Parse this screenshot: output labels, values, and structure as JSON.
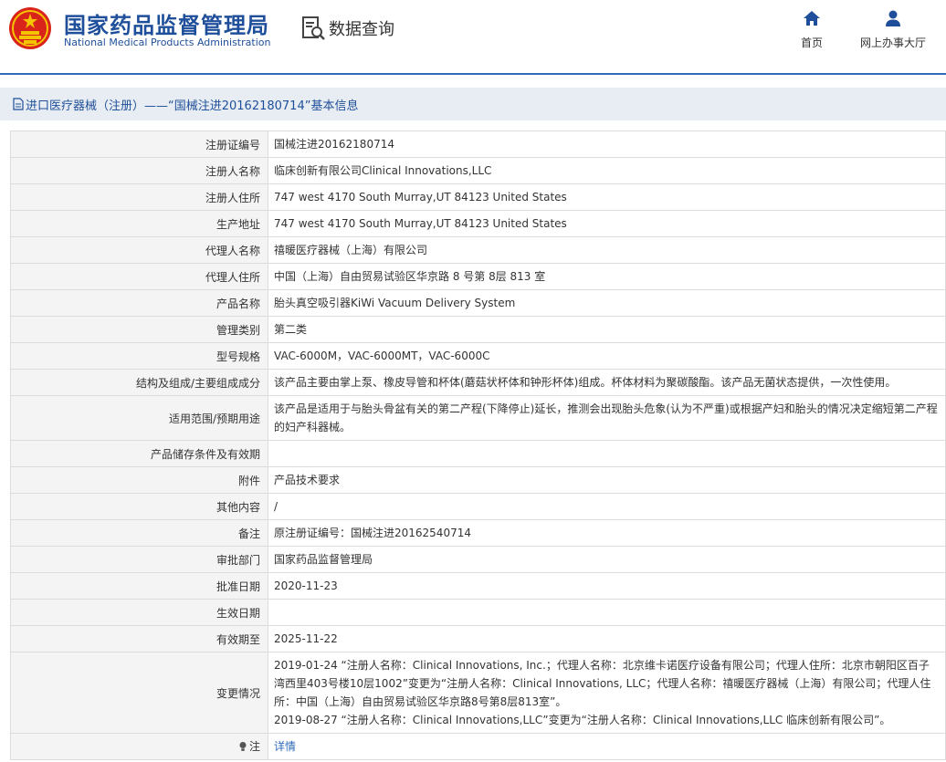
{
  "header": {
    "brand_cn": "国家药品监督管理局",
    "brand_en": "National Medical Products Administration",
    "query_label": "数据查询",
    "nav_home": "首页",
    "nav_hall": "网上办事大厅",
    "brand_color": "#1f4f9a",
    "emblem_color": "#d9241c"
  },
  "breadcrumb": "进口医疗器械（注册）——“国械注进20162180714”基本信息",
  "rows": [
    {
      "label": "注册证编号",
      "value": "国械注进20162180714"
    },
    {
      "label": "注册人名称",
      "value": "临床创新有限公司Clinical Innovations,LLC"
    },
    {
      "label": "注册人住所",
      "value": "747 west 4170 South Murray,UT 84123 United States"
    },
    {
      "label": "生产地址",
      "value": "747 west 4170 South Murray,UT 84123 United States"
    },
    {
      "label": "代理人名称",
      "value": "禧暖医疗器械（上海）有限公司"
    },
    {
      "label": "代理人住所",
      "value": "中国（上海）自由贸易试验区华京路 8 号第 8层 813 室"
    },
    {
      "label": "产品名称",
      "value": "胎头真空吸引器KiWi Vacuum Delivery System"
    },
    {
      "label": "管理类别",
      "value": "第二类"
    },
    {
      "label": "型号规格",
      "value": "VAC-6000M，VAC-6000MT，VAC-6000C"
    },
    {
      "label": "结构及组成/主要组成成分",
      "value": "该产品主要由掌上泵、橡皮导管和杯体(蘑菇状杯体和钟形杯体)组成。杯体材料为聚碳酸酯。该产品无菌状态提供，一次性使用。"
    },
    {
      "label": "适用范围/预期用途",
      "value": "该产品是适用于与胎头骨盆有关的第二产程(下降停止)延长，推测会出现胎头危象(认为不严重)或根据产妇和胎头的情况决定缩短第二产程的妇产科器械。"
    },
    {
      "label": "产品储存条件及有效期",
      "value": ""
    },
    {
      "label": "附件",
      "value": "产品技术要求"
    },
    {
      "label": "其他内容",
      "value": "/"
    },
    {
      "label": "备注",
      "value": "原注册证编号：国械注进20162540714"
    },
    {
      "label": "审批部门",
      "value": "国家药品监督管理局"
    },
    {
      "label": "批准日期",
      "value": "2020-11-23"
    },
    {
      "label": "生效日期",
      "value": ""
    },
    {
      "label": "有效期至",
      "value": "2025-11-22"
    }
  ],
  "change": {
    "label": "变更情况",
    "line1": "2019-01-24 “注册人名称：Clinical Innovations, Inc.；代理人名称：北京维卡诺医疗设备有限公司；代理人住所：北京市朝阳区百子湾西里403号楼10层1002”变更为“注册人名称：Clinical Innovations, LLC；代理人名称：禧暖医疗器械（上海）有限公司；代理人住所：中国（上海）自由贸易试验区华京路8号第8层813室”。",
    "line2": "2019-08-27 “注册人名称：Clinical Innovations,LLC”变更为“注册人名称：Clinical Innovations,LLC 临床创新有限公司”。"
  },
  "note": {
    "label": "注",
    "link": "详情"
  }
}
